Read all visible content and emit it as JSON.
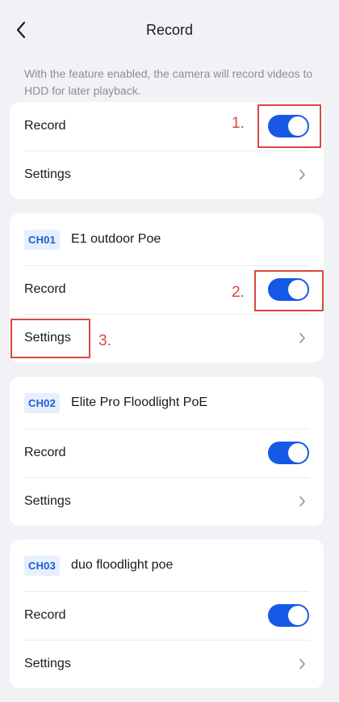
{
  "header": {
    "title": "Record",
    "back_icon": "chevron-left-icon"
  },
  "description": "With the feature enabled, the camera will record videos to HDD for later playback.",
  "global": {
    "record_label": "Record",
    "record_enabled": true,
    "settings_label": "Settings"
  },
  "channels": [
    {
      "badge": "CH01",
      "name": "E1 outdoor Poe",
      "record_label": "Record",
      "record_enabled": true,
      "settings_label": "Settings"
    },
    {
      "badge": "CH02",
      "name": "Elite Pro Floodlight PoE",
      "record_label": "Record",
      "record_enabled": true,
      "settings_label": "Settings"
    },
    {
      "badge": "CH03",
      "name": "duo floodlight poe",
      "record_label": "Record",
      "record_enabled": true,
      "settings_label": "Settings"
    }
  ],
  "annotations": [
    "1.",
    "2.",
    "3."
  ],
  "colors": {
    "accent": "#1659e6",
    "annotation": "#d94840",
    "badge_bg": "#e7effd",
    "background": "#f1f2f6"
  }
}
